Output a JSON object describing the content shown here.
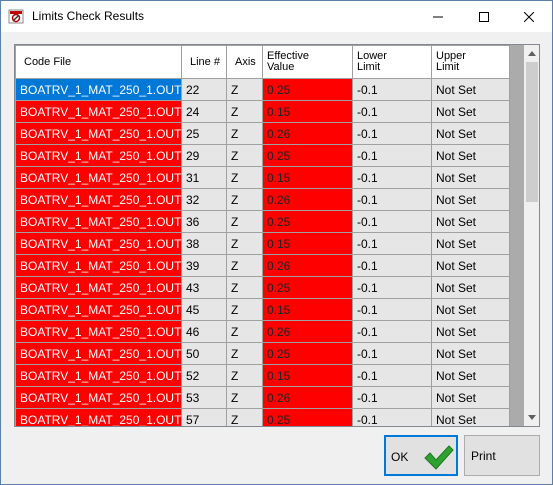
{
  "window": {
    "title": "Limits Check Results"
  },
  "table": {
    "columns": [
      {
        "name": "code-file",
        "lines": [
          "Code File"
        ]
      },
      {
        "name": "line-number",
        "lines": [
          "Line #"
        ]
      },
      {
        "name": "axis",
        "lines": [
          "Axis"
        ]
      },
      {
        "name": "effective-value",
        "lines": [
          "Effective",
          "Value"
        ]
      },
      {
        "name": "lower-limit",
        "lines": [
          "Lower",
          "Limit"
        ]
      },
      {
        "name": "upper-limit",
        "lines": [
          "Upper",
          "Limit"
        ]
      }
    ],
    "rows": [
      [
        "BOATRV_1_MAT_250_1.OUT",
        "22",
        "Z",
        "0.25",
        "-0.1",
        "Not Set"
      ],
      [
        "BOATRV_1_MAT_250_1.OUT",
        "24",
        "Z",
        "0.15",
        "-0.1",
        "Not Set"
      ],
      [
        "BOATRV_1_MAT_250_1.OUT",
        "25",
        "Z",
        "0.26",
        "-0.1",
        "Not Set"
      ],
      [
        "BOATRV_1_MAT_250_1.OUT",
        "29",
        "Z",
        "0.25",
        "-0.1",
        "Not Set"
      ],
      [
        "BOATRV_1_MAT_250_1.OUT",
        "31",
        "Z",
        "0.15",
        "-0.1",
        "Not Set"
      ],
      [
        "BOATRV_1_MAT_250_1.OUT",
        "32",
        "Z",
        "0.26",
        "-0.1",
        "Not Set"
      ],
      [
        "BOATRV_1_MAT_250_1.OUT",
        "36",
        "Z",
        "0.25",
        "-0.1",
        "Not Set"
      ],
      [
        "BOATRV_1_MAT_250_1.OUT",
        "38",
        "Z",
        "0.15",
        "-0.1",
        "Not Set"
      ],
      [
        "BOATRV_1_MAT_250_1.OUT",
        "39",
        "Z",
        "0.26",
        "-0.1",
        "Not Set"
      ],
      [
        "BOATRV_1_MAT_250_1.OUT",
        "43",
        "Z",
        "0.25",
        "-0.1",
        "Not Set"
      ],
      [
        "BOATRV_1_MAT_250_1.OUT",
        "45",
        "Z",
        "0.15",
        "-0.1",
        "Not Set"
      ],
      [
        "BOATRV_1_MAT_250_1.OUT",
        "46",
        "Z",
        "0.26",
        "-0.1",
        "Not Set"
      ],
      [
        "BOATRV_1_MAT_250_1.OUT",
        "50",
        "Z",
        "0.25",
        "-0.1",
        "Not Set"
      ],
      [
        "BOATRV_1_MAT_250_1.OUT",
        "52",
        "Z",
        "0.15",
        "-0.1",
        "Not Set"
      ],
      [
        "BOATRV_1_MAT_250_1.OUT",
        "53",
        "Z",
        "0.26",
        "-0.1",
        "Not Set"
      ],
      [
        "BOATRV_1_MAT_250_1.OUT",
        "57",
        "Z",
        "0.25",
        "-0.1",
        "Not Set"
      ]
    ],
    "selected_row": 0
  },
  "buttons": {
    "ok_label": "OK",
    "print_label": "Print"
  },
  "icons": {
    "app": "limits-check-app-icon",
    "minimize": "minimize-icon",
    "maximize": "maximize-icon",
    "close": "close-icon",
    "ok": "checkmark-icon",
    "scroll_up": "scroll-up-arrow-icon",
    "scroll_down": "scroll-down-arrow-icon"
  },
  "colors": {
    "failed_cell": "#ff0000",
    "selected_cell": "#0078d7",
    "grid_background": "#ababab",
    "default_button_border": "#0078d7",
    "check_green": "#2fa12f"
  }
}
